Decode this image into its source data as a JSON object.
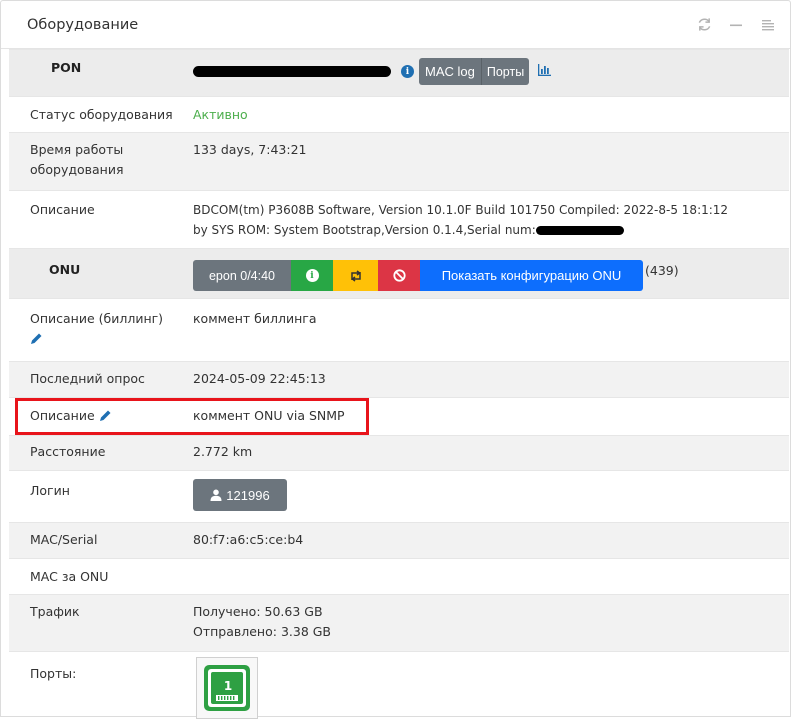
{
  "panel": {
    "title": "Оборудование",
    "tools": [
      "refresh-icon",
      "minimize-icon",
      "menu-icon"
    ]
  },
  "pon": {
    "label": "PON",
    "mac_log_label": "MAC log",
    "ports_label": "Порты"
  },
  "equipment": {
    "status_label": "Статус оборудования",
    "status_value": "Активно",
    "uptime_label_1": "Время работы",
    "uptime_label_2": "оборудования",
    "uptime_value": "133 days, 7:43:21",
    "description_label": "Описание",
    "description_line1": "BDCOM(tm) P3608B Software, Version 10.1.0F Build 101750 Compiled: 2022-8-5 18:1:12",
    "description_line2": "by SYS ROM: System Bootstrap,Version 0.1.4,Serial num:"
  },
  "onu": {
    "label": "ONU",
    "port_button": "epon 0/4:40",
    "config_button": "Показать конфигурацию ONU",
    "count": "(439)",
    "billing_desc_label": "Описание (биллинг)",
    "billing_desc_value": "коммент биллинга",
    "last_poll_label": "Последний опрос",
    "last_poll_value": "2024-05-09 22:45:13",
    "desc_label": "Описание",
    "desc_value": "коммент ONU via SNMP",
    "distance_label": "Расстояние",
    "distance_value": "2.772 km",
    "login_label": "Логин",
    "login_value": "121996",
    "mac_label": "MAC/Serial",
    "mac_value": "80:f7:a6:c5:ce:b4",
    "mac_behind_label": "MAC за ONU",
    "traffic_label": "Трафик",
    "traffic_rx": "Получено: 50.63 GB",
    "traffic_tx": "Отправлено: 3.38 GB",
    "ports_label": "Порты:",
    "port_number": "1"
  },
  "colors": {
    "status_active": "#4cae4c",
    "highlight": "#e8141b",
    "button_gray": "#6c757d",
    "button_green": "#28a745",
    "button_yellow": "#ffc107",
    "button_red": "#dc3545",
    "button_blue": "#0d6efd",
    "port_green": "#2ea043"
  }
}
